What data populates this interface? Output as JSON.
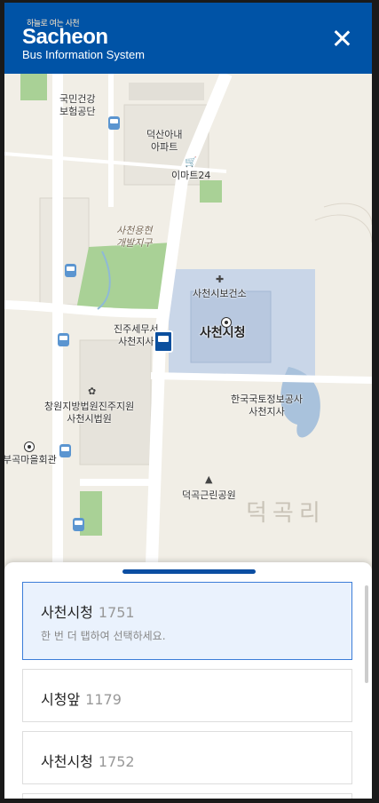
{
  "header": {
    "tagline": "하늘로 여는 사천",
    "logo": "Sacheon",
    "subtitle": "Bus Information System",
    "accent_color": "#0053a6",
    "logo_accent": "#f06b25"
  },
  "map": {
    "labels": {
      "nhis": "국민건강\n보험공단",
      "apartment": "덕산아내\n아파트",
      "emart24": "이마트24",
      "development": "사천용현\n개발지구",
      "health_center": "사천시보건소",
      "tax_office": "진주세무서\n사천지사",
      "city_hall": "사천시청",
      "court": "창원지방법원진주지원\n사천시법원",
      "kr_land": "한국국토정보공사\n사천지사",
      "village_hall": "부곡마을회관",
      "park": "덕곡근린공원",
      "district": "덕곡리"
    },
    "icons": [
      "bus-stop-icon",
      "bus-active-icon",
      "cart-icon",
      "cross-icon",
      "poi-icon",
      "tree-icon",
      "flower-icon"
    ]
  },
  "sheet": {
    "stops": [
      {
        "name": "사천시청",
        "number": "1751",
        "hint": "한 번 더 탭하여 선택하세요.",
        "selected": true
      },
      {
        "name": "시청앞",
        "number": "1179"
      },
      {
        "name": "사천시청",
        "number": "1752"
      }
    ],
    "selected_color": "#eaf2fd"
  }
}
